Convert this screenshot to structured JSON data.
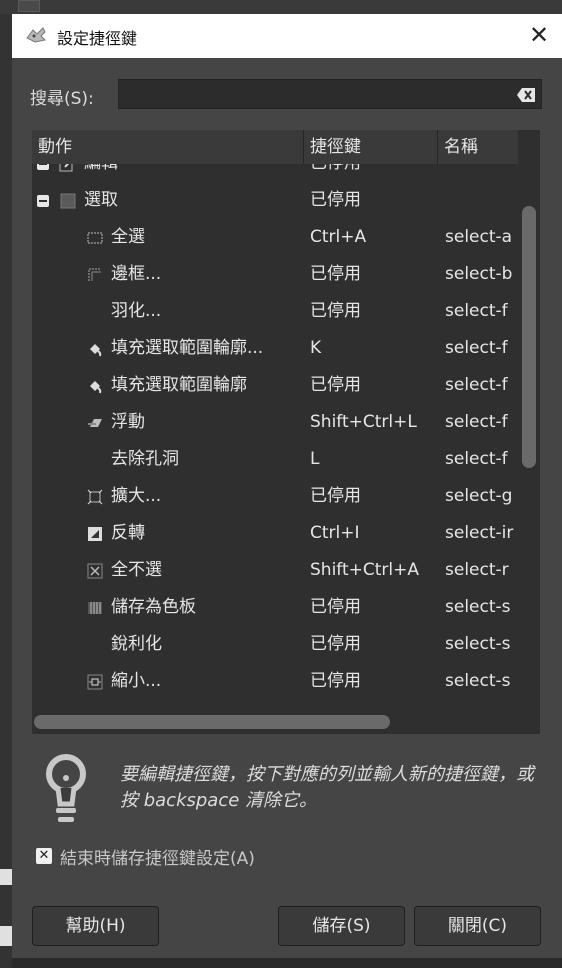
{
  "window": {
    "title": "設定捷徑鍵",
    "close_symbol": "✕"
  },
  "search": {
    "label": "搜尋(S):",
    "value": ""
  },
  "columns": {
    "action": "動作",
    "shortcut": "捷徑鍵",
    "name": "名稱"
  },
  "rows": [
    {
      "name": "編輯",
      "shortcut": "已停用",
      "action": "",
      "icon": "edit-icon",
      "expander": "expanded-group"
    },
    {
      "name": "選取",
      "shortcut": "已停用",
      "action": "",
      "icon": "selection-group-icon",
      "expander": "collapse"
    },
    {
      "name": "全選",
      "shortcut": "Ctrl+A",
      "action": "select-a",
      "icon": "select-all-icon"
    },
    {
      "name": "邊框...",
      "shortcut": "已停用",
      "action": "select-b",
      "icon": "select-border-icon"
    },
    {
      "name": "羽化...",
      "shortcut": "已停用",
      "action": "select-f",
      "icon": ""
    },
    {
      "name": "填充選取範圍輪廓...",
      "shortcut": "K",
      "action": "select-f",
      "icon": "bucket-fill-icon"
    },
    {
      "name": "填充選取範圍輪廓",
      "shortcut": "已停用",
      "action": "select-f",
      "icon": "bucket-fill-icon"
    },
    {
      "name": "浮動",
      "shortcut": "Shift+Ctrl+L",
      "action": "select-f",
      "icon": "float-icon"
    },
    {
      "name": "去除孔洞",
      "shortcut": "L",
      "action": "select-f",
      "icon": ""
    },
    {
      "name": "擴大...",
      "shortcut": "已停用",
      "action": "select-g",
      "icon": "grow-icon"
    },
    {
      "name": "反轉",
      "shortcut": "Ctrl+I",
      "action": "select-ir",
      "icon": "invert-icon"
    },
    {
      "name": "全不選",
      "shortcut": "Shift+Ctrl+A",
      "action": "select-r",
      "icon": "select-none-icon"
    },
    {
      "name": "儲存為色板",
      "shortcut": "已停用",
      "action": "select-s",
      "icon": "save-channel-icon"
    },
    {
      "name": "銳利化",
      "shortcut": "已停用",
      "action": "select-s",
      "icon": ""
    },
    {
      "name": "縮小...",
      "shortcut": "已停用",
      "action": "select-s",
      "icon": "shrink-icon"
    }
  ],
  "hint": {
    "text": "要編輯捷徑鍵，按下對應的列並輸人新的捷徑鍵，或按 backspace 清除它。",
    "icon": "lightbulb-icon"
  },
  "save_on_exit": {
    "label": "結束時儲存捷徑鍵設定(A)",
    "checked": true
  },
  "buttons": {
    "help": "幫助(H)",
    "save": "儲存(S)",
    "close": "關閉(C)"
  }
}
